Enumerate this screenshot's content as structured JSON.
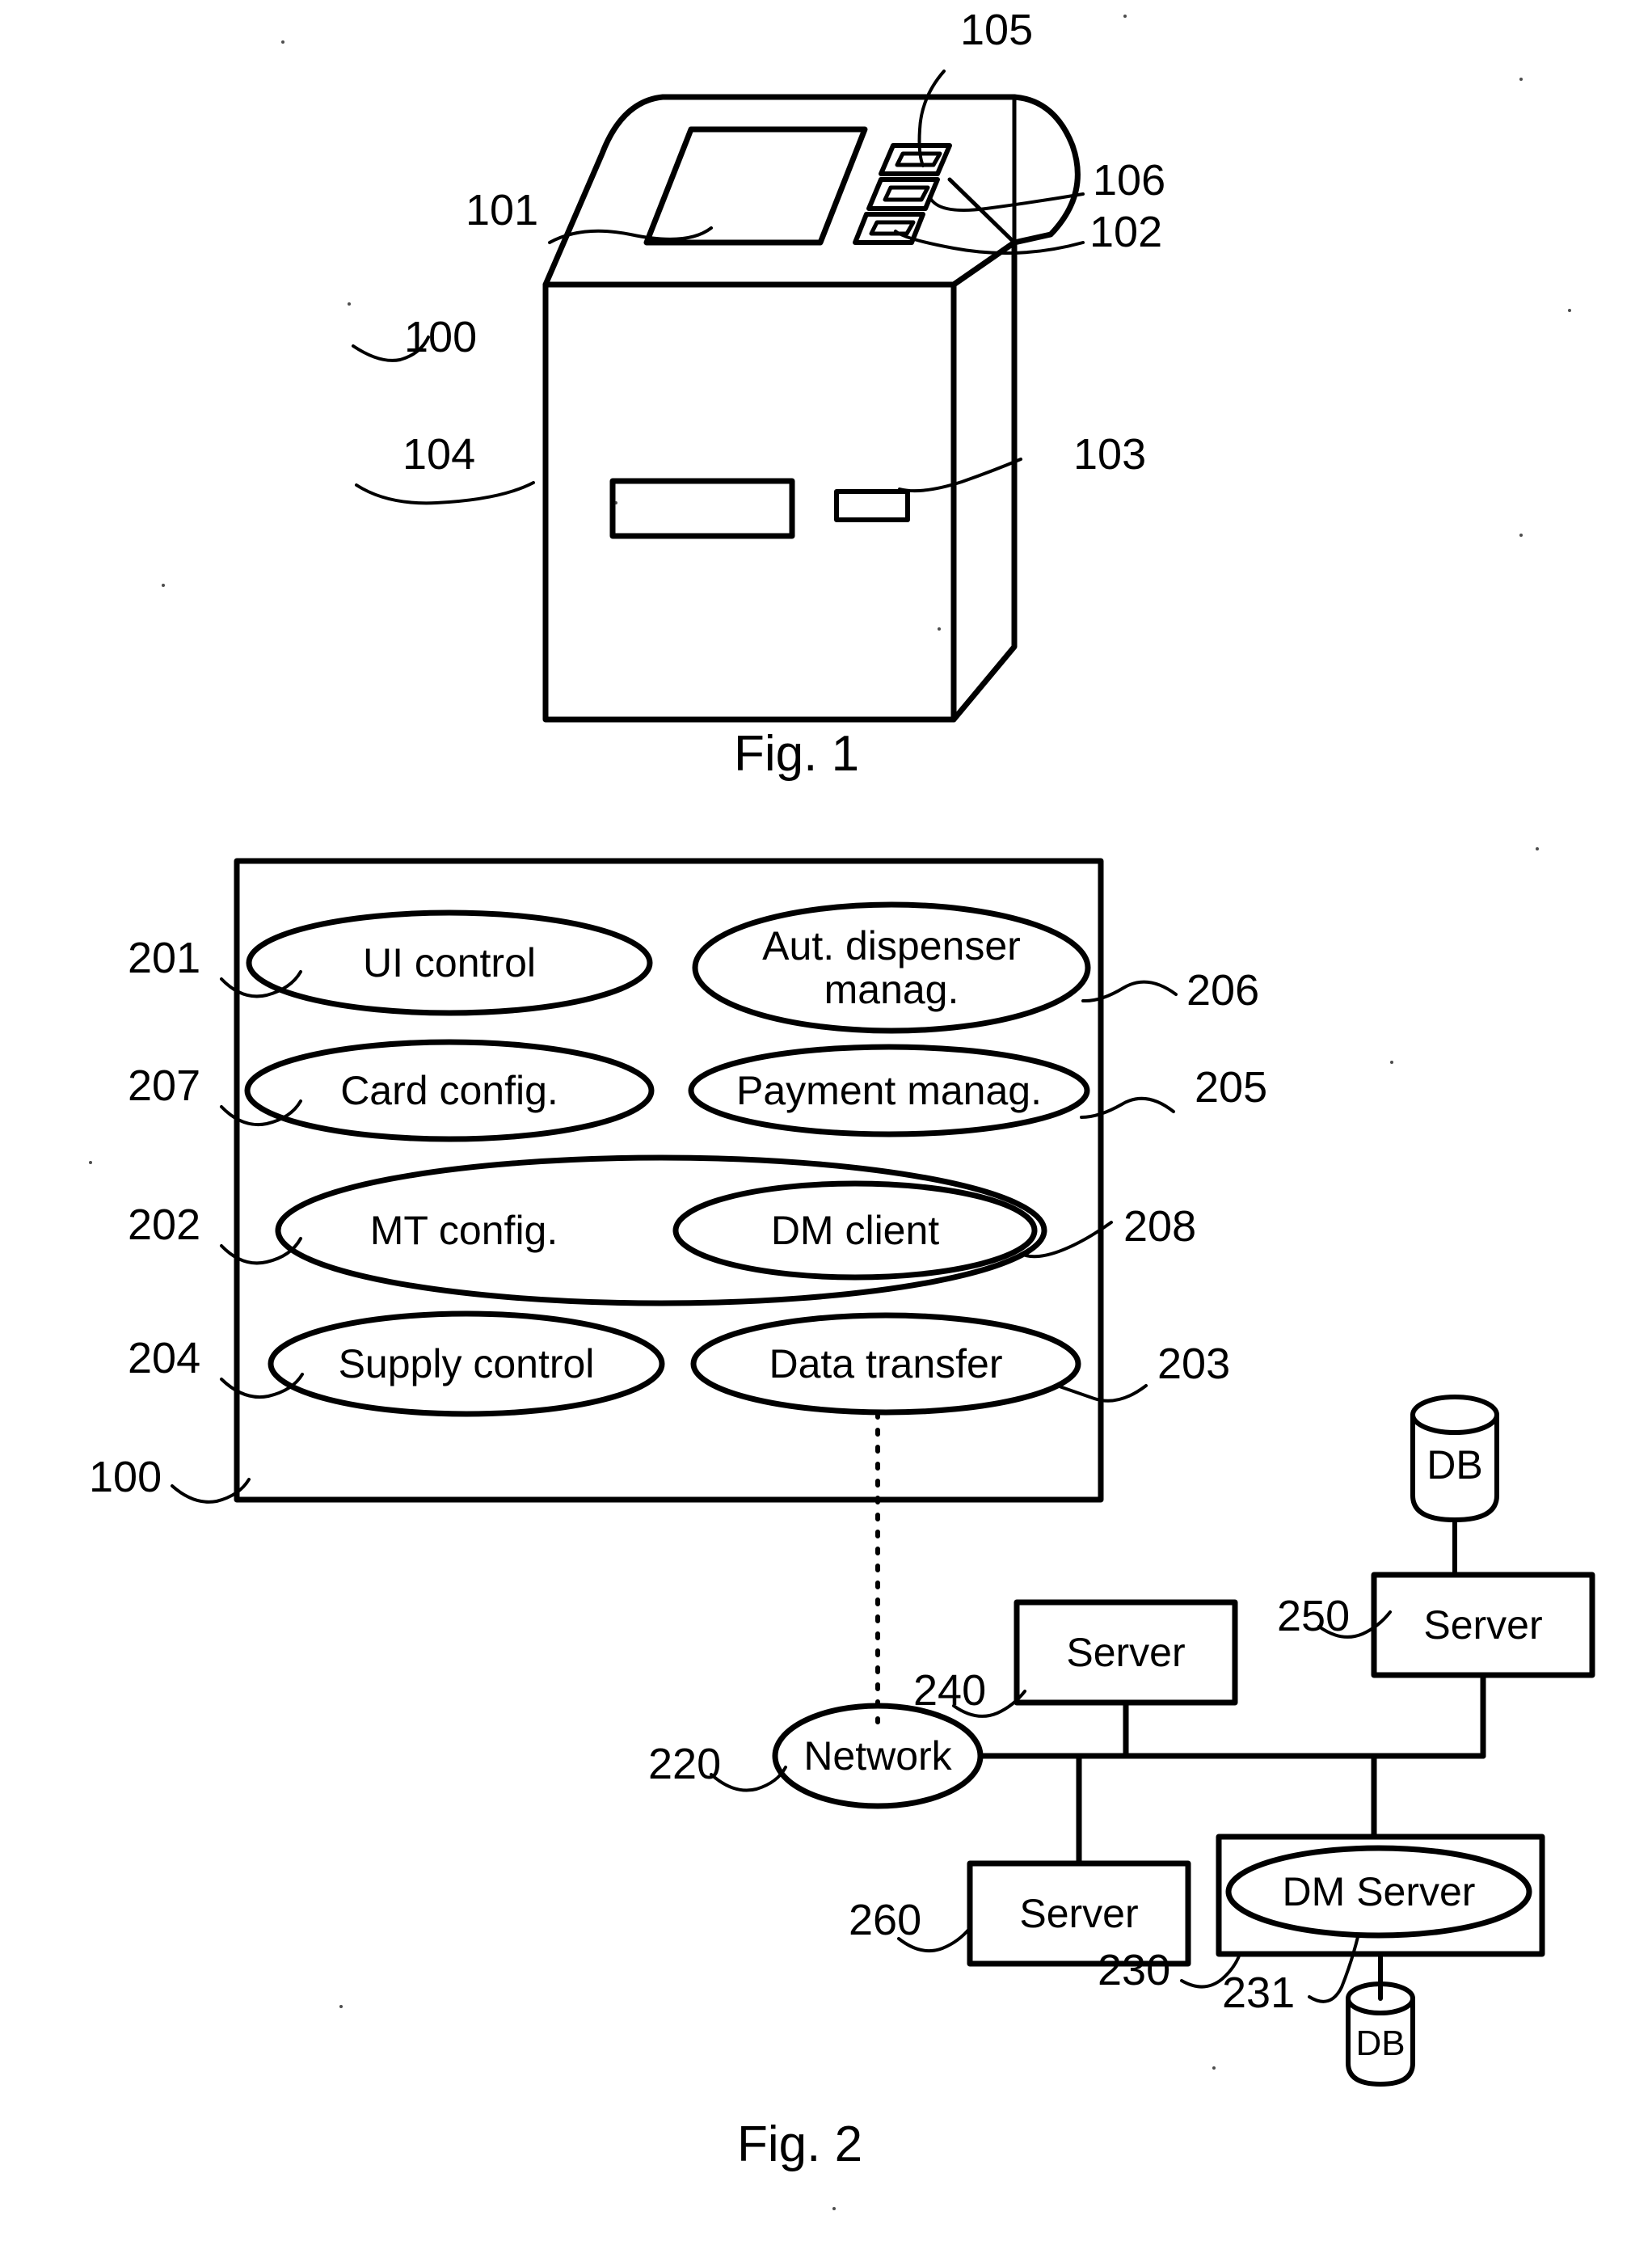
{
  "document": {
    "type": "patent-drawing-sheet",
    "figures": [
      {
        "id": "fig1",
        "caption": "Fig. 1"
      },
      {
        "id": "fig2",
        "caption": "Fig. 2"
      }
    ]
  },
  "fig1": {
    "caption": "Fig. 1",
    "title": "Automated teller machine perspective view",
    "reference_numerals": [
      {
        "id": "105",
        "label": "105",
        "refers_to": "card-reader-slot"
      },
      {
        "id": "101",
        "label": "101",
        "refers_to": "display-screen"
      },
      {
        "id": "106",
        "label": "106",
        "refers_to": "receipt-slot"
      },
      {
        "id": "102",
        "label": "102",
        "refers_to": "keypad-slot"
      },
      {
        "id": "100",
        "label": "100",
        "refers_to": "atm-housing"
      },
      {
        "id": "104",
        "label": "104",
        "refers_to": "cash-dispenser-opening"
      },
      {
        "id": "103",
        "label": "103",
        "refers_to": "deposit-opening"
      }
    ]
  },
  "fig2": {
    "caption": "Fig. 2",
    "title": "System block diagram",
    "machine_box": {
      "label": "100",
      "refers_to": "atm-software-container"
    },
    "modules": [
      {
        "num": "201",
        "label": "UI control",
        "side": "left",
        "row": 1
      },
      {
        "num": "206",
        "label": "Aut. dispenser manag.",
        "label_line1": "Aut. dispenser",
        "label_line2": "manag.",
        "side": "right",
        "row": 1
      },
      {
        "num": "207",
        "label": "Card config.",
        "side": "left",
        "row": 2
      },
      {
        "num": "205",
        "label": "Payment manag.",
        "side": "right",
        "row": 2
      },
      {
        "num": "202",
        "label": "MT config.",
        "side": "left",
        "row": 3,
        "outer": true
      },
      {
        "num": "208",
        "label": "DM client",
        "side": "right",
        "row": 3,
        "nested_in": "202"
      },
      {
        "num": "204",
        "label": "Supply control",
        "side": "left",
        "row": 4
      },
      {
        "num": "203",
        "label": "Data transfer",
        "side": "right",
        "row": 4
      }
    ],
    "network": {
      "num": "220",
      "label": "Network"
    },
    "nodes": [
      {
        "num": "240",
        "label": "Server",
        "shape": "rect"
      },
      {
        "num": "250",
        "label": "Server",
        "shape": "rect"
      },
      {
        "num": "260",
        "label": "Server",
        "shape": "rect"
      },
      {
        "num": "230",
        "label": "",
        "shape": "rect",
        "refers_to": "dm-server-container"
      },
      {
        "num": "231",
        "label": "DM Server",
        "shape": "ellipse"
      }
    ],
    "databases": [
      {
        "label": "DB",
        "attached_to": "250"
      },
      {
        "label": "DB",
        "attached_to": "231"
      }
    ]
  },
  "style": {
    "ink": "#000000",
    "paper": "#ffffff"
  }
}
